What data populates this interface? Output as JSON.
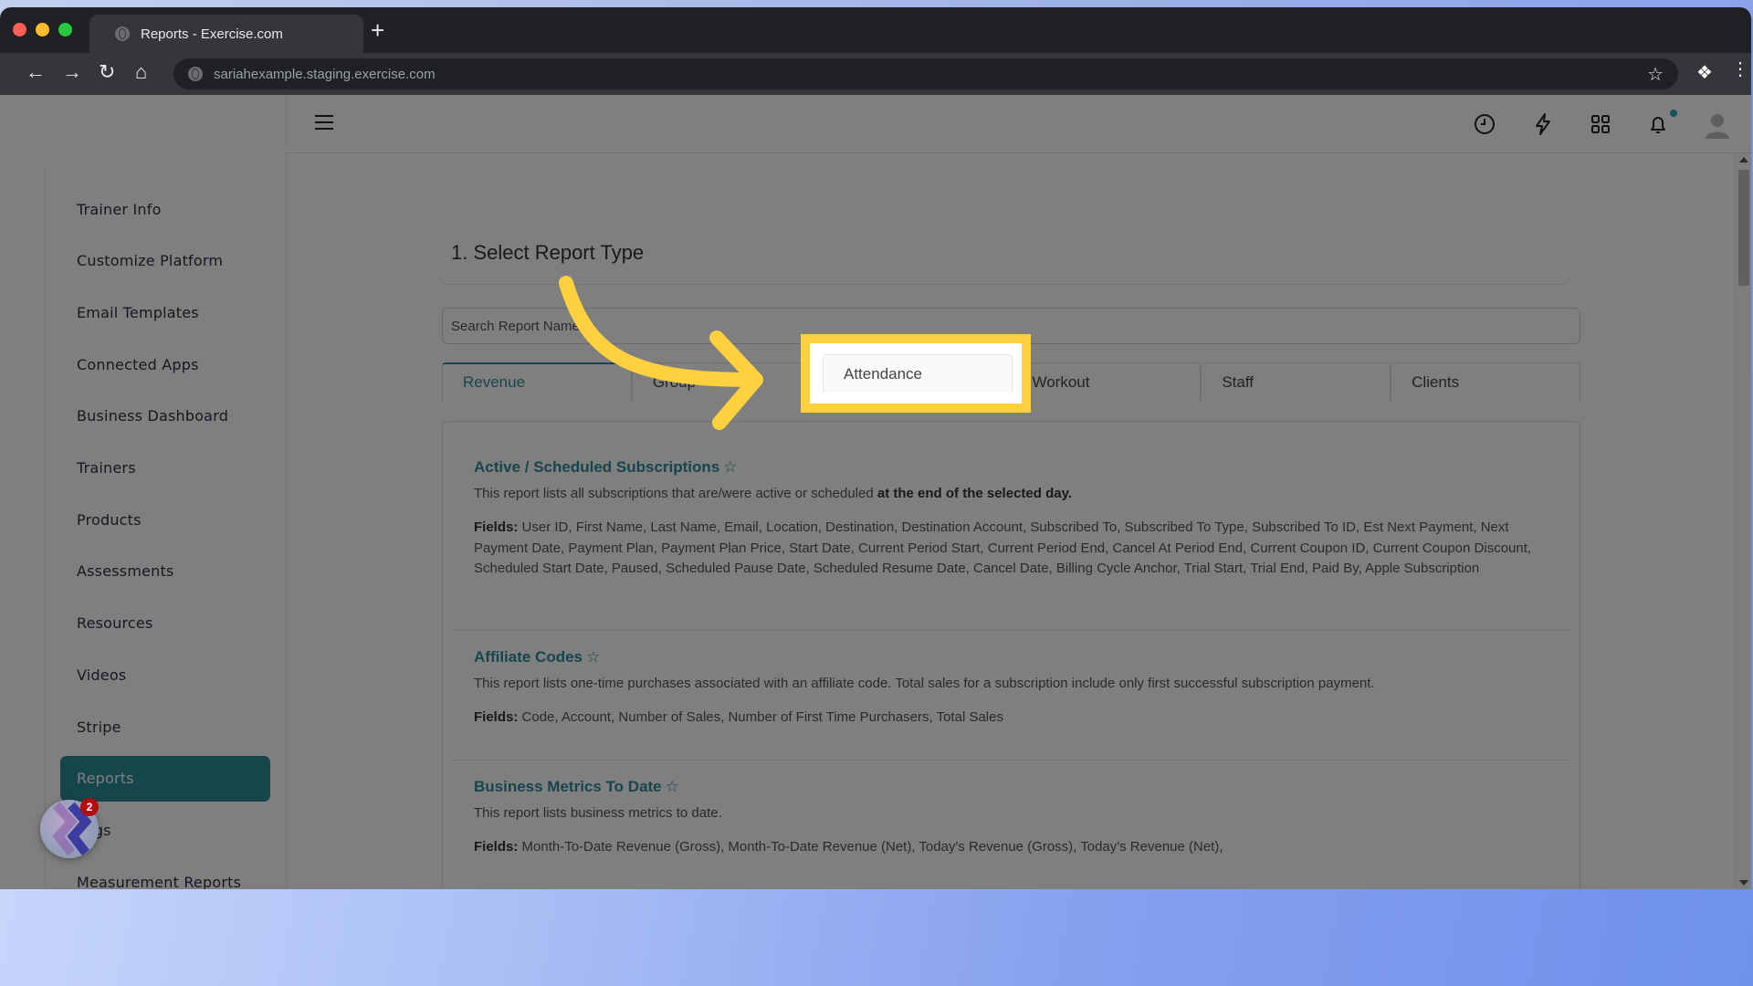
{
  "browser": {
    "tab_title": "Reports - Exercise.com",
    "url": "sariahexample.staging.exercise.com",
    "new_tab_label": "+"
  },
  "sidebar": {
    "items": [
      {
        "label": "Trainer Info",
        "active": false
      },
      {
        "label": "Customize Platform",
        "active": false
      },
      {
        "label": "Email Templates",
        "active": false
      },
      {
        "label": "Connected Apps",
        "active": false
      },
      {
        "label": "Business Dashboard",
        "active": false
      },
      {
        "label": "Trainers",
        "active": false
      },
      {
        "label": "Products",
        "active": false
      },
      {
        "label": "Assessments",
        "active": false
      },
      {
        "label": "Resources",
        "active": false
      },
      {
        "label": "Videos",
        "active": false
      },
      {
        "label": "Stripe",
        "active": false
      },
      {
        "label": "Reports",
        "active": true
      },
      {
        "label": "Logs",
        "active": false
      },
      {
        "label": "Measurement Reports",
        "active": false
      }
    ]
  },
  "header": {
    "icons": [
      "history-icon",
      "lightning-icon",
      "apps-grid-icon",
      "bell-icon",
      "user-avatar-icon"
    ],
    "notification_dot_color": "#2fa3b6"
  },
  "main": {
    "section_title": "1. Select Report Type",
    "search_placeholder": "Search Report Name",
    "tabs": [
      {
        "label": "Revenue",
        "active": true
      },
      {
        "label": "Group",
        "active": false
      },
      {
        "label": "Attendance",
        "active": false
      },
      {
        "label": "Workout",
        "active": false
      },
      {
        "label": "Staff",
        "active": false
      },
      {
        "label": "Clients",
        "active": false
      }
    ],
    "reports": [
      {
        "title": "Active / Scheduled Subscriptions",
        "description": "This report lists all subscriptions that are/were active or scheduled",
        "description_bold": "at the end of the selected day.",
        "fields_label": "Fields:",
        "fields": "User ID, First Name, Last Name, Email, Location, Destination, Destination Account, Subscribed To, Subscribed To Type, Subscribed To ID, Est Next Payment, Next Payment Date, Payment Plan, Payment Plan Price, Start Date, Current Period Start, Current Period End, Cancel At Period End, Current Coupon ID, Current Coupon Discount, Scheduled Start Date, Paused, Scheduled Pause Date, Scheduled Resume Date, Cancel Date, Billing Cycle Anchor, Trial Start, Trial End, Paid By, Apple Subscription"
      },
      {
        "title": "Affiliate Codes",
        "description": "This report lists one-time purchases associated with an affiliate code. Total sales for a subscription include only first successful subscription payment.",
        "description_bold": "",
        "fields_label": "Fields:",
        "fields": "Code, Account, Number of Sales, Number of First Time Purchasers, Total Sales"
      },
      {
        "title": "Business Metrics To Date",
        "description": "This report lists business metrics to date.",
        "description_bold": "",
        "fields_label": "Fields:",
        "fields": "Month-To-Date Revenue (Gross), Month-To-Date Revenue (Net), Today's Revenue (Gross), Today's Revenue (Net),"
      }
    ]
  },
  "annotation": {
    "highlighted_tab": "Attendance",
    "highlight_color": "#ffd13f"
  },
  "helper_widget": {
    "badge_count": "2"
  },
  "colors": {
    "accent": "#2f8a99",
    "browser_dark": "#202124"
  }
}
